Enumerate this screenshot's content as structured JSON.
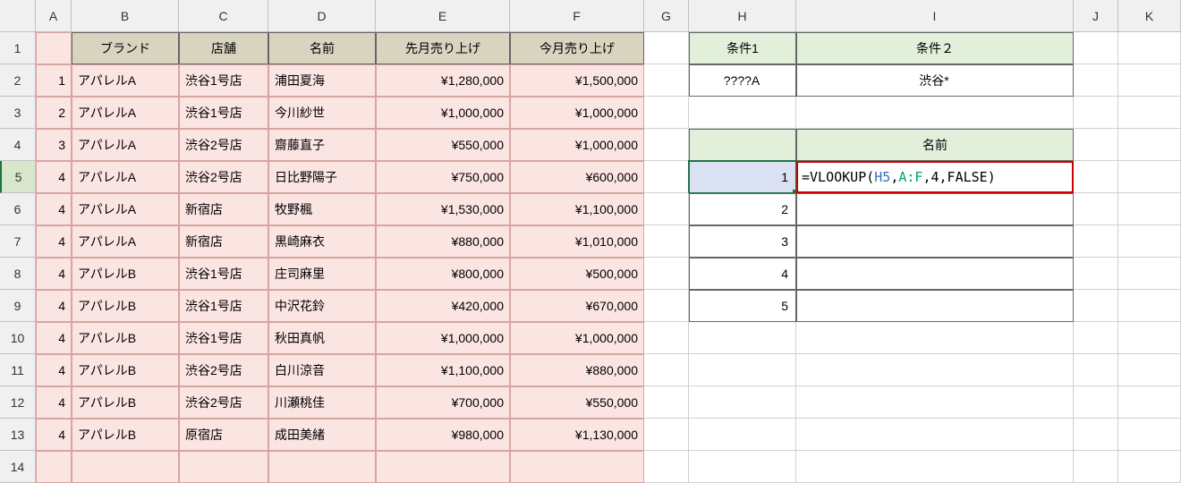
{
  "columns": [
    "A",
    "B",
    "C",
    "D",
    "E",
    "F",
    "G",
    "H",
    "I",
    "J",
    "K"
  ],
  "rows": [
    "1",
    "2",
    "3",
    "4",
    "5",
    "6",
    "7",
    "8",
    "9",
    "10",
    "11",
    "12",
    "13",
    "14"
  ],
  "tableHeaders": {
    "B": "ブランド",
    "C": "店舗",
    "D": "名前",
    "E": "先月売り上げ",
    "F": "今月売り上げ"
  },
  "tableData": [
    {
      "A": "1",
      "B": "アパレルA",
      "C": "渋谷1号店",
      "D": "浦田夏海",
      "E": "¥1,280,000",
      "F": "¥1,500,000"
    },
    {
      "A": "2",
      "B": "アパレルA",
      "C": "渋谷1号店",
      "D": "今川紗世",
      "E": "¥1,000,000",
      "F": "¥1,000,000"
    },
    {
      "A": "3",
      "B": "アパレルA",
      "C": "渋谷2号店",
      "D": "齋藤直子",
      "E": "¥550,000",
      "F": "¥1,000,000"
    },
    {
      "A": "4",
      "B": "アパレルA",
      "C": "渋谷2号店",
      "D": "日比野陽子",
      "E": "¥750,000",
      "F": "¥600,000"
    },
    {
      "A": "4",
      "B": "アパレルA",
      "C": "新宿店",
      "D": "牧野楓",
      "E": "¥1,530,000",
      "F": "¥1,100,000"
    },
    {
      "A": "4",
      "B": "アパレルA",
      "C": "新宿店",
      "D": "黒崎麻衣",
      "E": "¥880,000",
      "F": "¥1,010,000"
    },
    {
      "A": "4",
      "B": "アパレルB",
      "C": "渋谷1号店",
      "D": "庄司麻里",
      "E": "¥800,000",
      "F": "¥500,000"
    },
    {
      "A": "4",
      "B": "アパレルB",
      "C": "渋谷1号店",
      "D": "中沢花鈴",
      "E": "¥420,000",
      "F": "¥670,000"
    },
    {
      "A": "4",
      "B": "アパレルB",
      "C": "渋谷1号店",
      "D": "秋田真帆",
      "E": "¥1,000,000",
      "F": "¥1,000,000"
    },
    {
      "A": "4",
      "B": "アパレルB",
      "C": "渋谷2号店",
      "D": "白川涼音",
      "E": "¥1,100,000",
      "F": "¥880,000"
    },
    {
      "A": "4",
      "B": "アパレルB",
      "C": "渋谷2号店",
      "D": "川瀬桃佳",
      "E": "¥700,000",
      "F": "¥550,000"
    },
    {
      "A": "4",
      "B": "アパレルB",
      "C": "原宿店",
      "D": "成田美緒",
      "E": "¥980,000",
      "F": "¥1,130,000"
    }
  ],
  "criteria": {
    "H1": "条件1",
    "I1": "条件２",
    "H2": "????A",
    "I2": "渋谷*",
    "I4": "名前"
  },
  "lookup": {
    "H5": "1",
    "H6": "2",
    "H7": "3",
    "H8": "4",
    "H9": "5",
    "formula_parts": [
      "=VLOOKUP(",
      "H5",
      ",",
      "A:F",
      ",4,FALSE)"
    ]
  }
}
